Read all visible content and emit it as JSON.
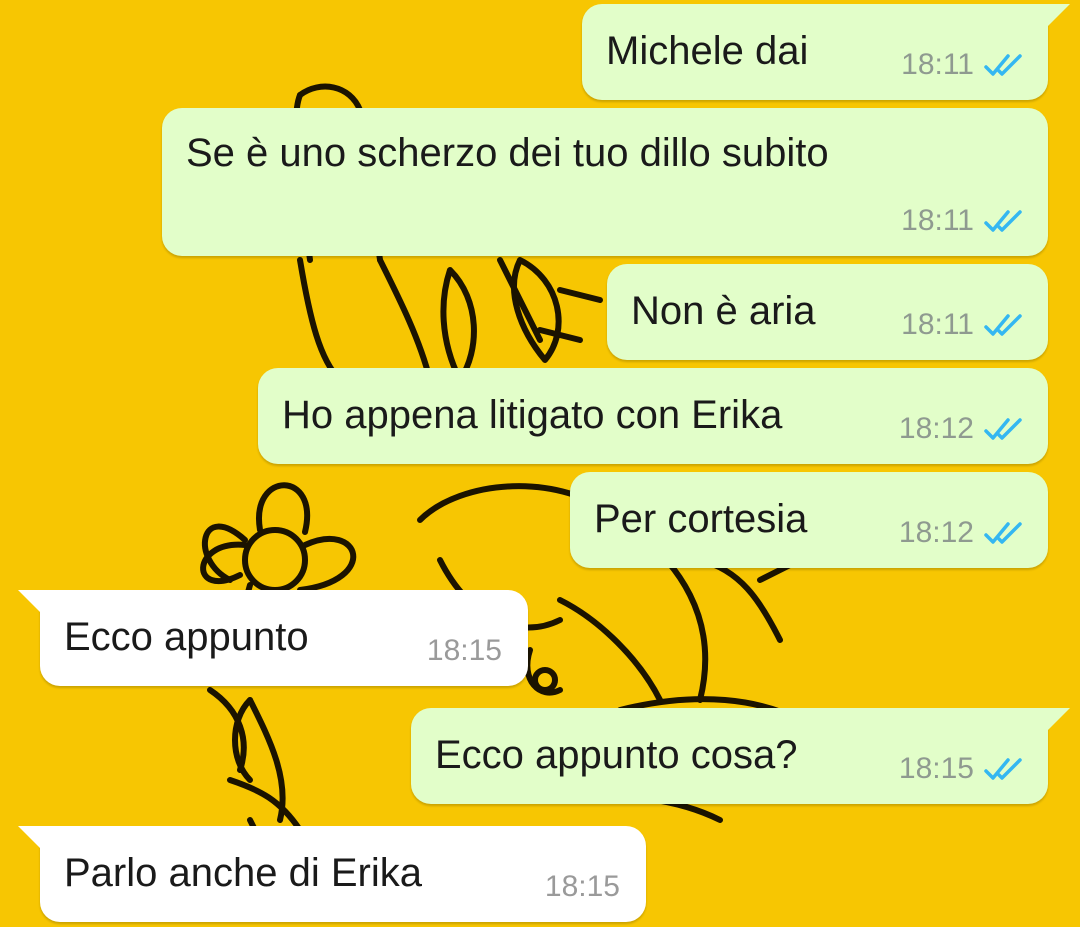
{
  "chat": {
    "colors": {
      "wallpaper": "#f7c602",
      "outgoing_bubble": "#e2fec9",
      "incoming_bubble": "#ffffff",
      "read_ticks": "#34b7f1"
    },
    "messages": [
      {
        "direction": "outgoing",
        "text": "Michele dai",
        "time": "18:11",
        "status": "read"
      },
      {
        "direction": "outgoing",
        "text": "Se è uno scherzo dei tuo dillo subito",
        "time": "18:11",
        "status": "read"
      },
      {
        "direction": "outgoing",
        "text": "Non è aria",
        "time": "18:11",
        "status": "read"
      },
      {
        "direction": "outgoing",
        "text": "Ho appena litigato con Erika",
        "time": "18:12",
        "status": "read"
      },
      {
        "direction": "outgoing",
        "text": "Per cortesia",
        "time": "18:12",
        "status": "read"
      },
      {
        "direction": "incoming",
        "text": "Ecco appunto",
        "time": "18:15"
      },
      {
        "direction": "outgoing",
        "text": "Ecco appunto cosa?",
        "time": "18:15",
        "status": "read"
      },
      {
        "direction": "incoming",
        "text": "Parlo anche di Erika",
        "time": "18:15"
      }
    ]
  }
}
